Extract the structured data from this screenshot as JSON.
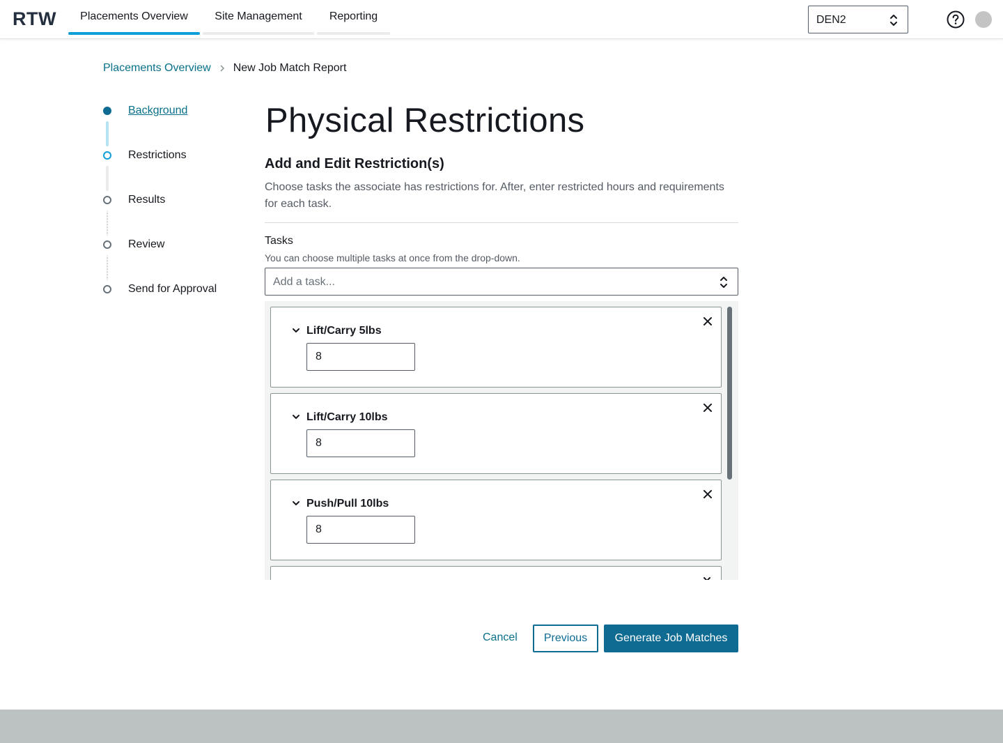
{
  "app": {
    "logo": "RTW"
  },
  "nav": {
    "tabs": [
      {
        "label": "Placements Overview",
        "active": true
      },
      {
        "label": "Site Management",
        "active": false
      },
      {
        "label": "Reporting",
        "active": false
      }
    ],
    "site_select": {
      "value": "DEN2"
    }
  },
  "breadcrumb": {
    "parent": "Placements Overview",
    "current": "New Job Match Report"
  },
  "steps": [
    {
      "label": "Background",
      "state": "completed"
    },
    {
      "label": "Restrictions",
      "state": "current"
    },
    {
      "label": "Results",
      "state": "upcoming"
    },
    {
      "label": "Review",
      "state": "upcoming"
    },
    {
      "label": "Send for Approval",
      "state": "upcoming"
    }
  ],
  "main": {
    "title": "Physical Restrictions",
    "section_title": "Add and Edit Restriction(s)",
    "section_description": "Choose tasks the associate has restrictions for. After, enter restricted hours and requirements for each task.",
    "tasks_label": "Tasks",
    "tasks_description": "You can choose multiple tasks at once from the drop-down.",
    "tasks_placeholder": "Add a task...",
    "tasks": [
      {
        "name": "Lift/Carry 5lbs",
        "hours": "8"
      },
      {
        "name": "Lift/Carry 10lbs",
        "hours": "8"
      },
      {
        "name": "Push/Pull 10lbs",
        "hours": "8"
      }
    ]
  },
  "actions": {
    "cancel": "Cancel",
    "previous": "Previous",
    "generate": "Generate Job Matches"
  },
  "colors": {
    "primary": "#0f6b92",
    "link": "#08708a",
    "nav_accent": "#0f9ed5",
    "footer_bar": "#bcc1c1"
  }
}
